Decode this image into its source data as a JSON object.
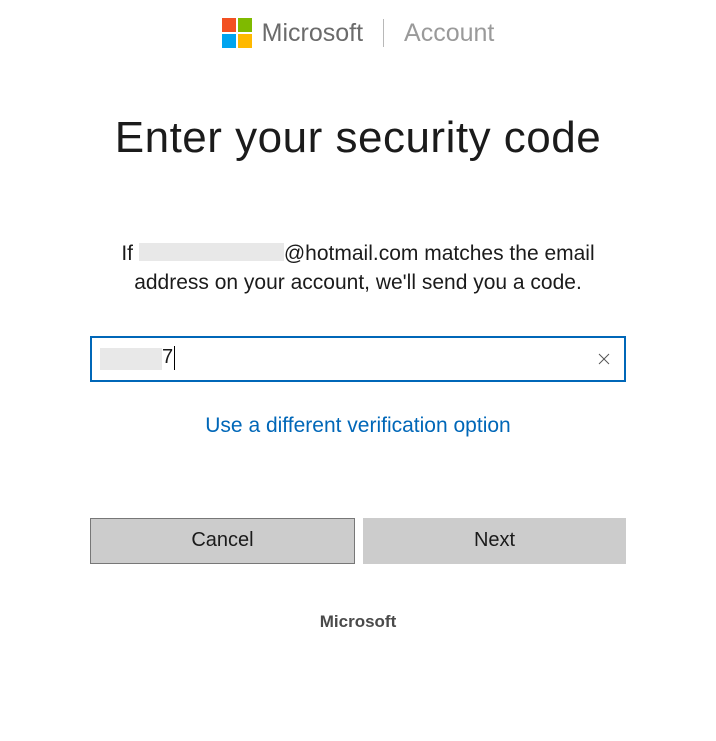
{
  "header": {
    "brand": "Microsoft",
    "section": "Account"
  },
  "main": {
    "title": "Enter your security code",
    "instruction_prefix": "If ",
    "instruction_email_domain": "@hotmail.com",
    "instruction_suffix": " matches the email address on your account, we'll send you a code.",
    "code_input_visible": "7",
    "alt_verification_link": "Use a different verification option"
  },
  "buttons": {
    "cancel": "Cancel",
    "next": "Next"
  },
  "footer": {
    "brand": "Microsoft"
  }
}
